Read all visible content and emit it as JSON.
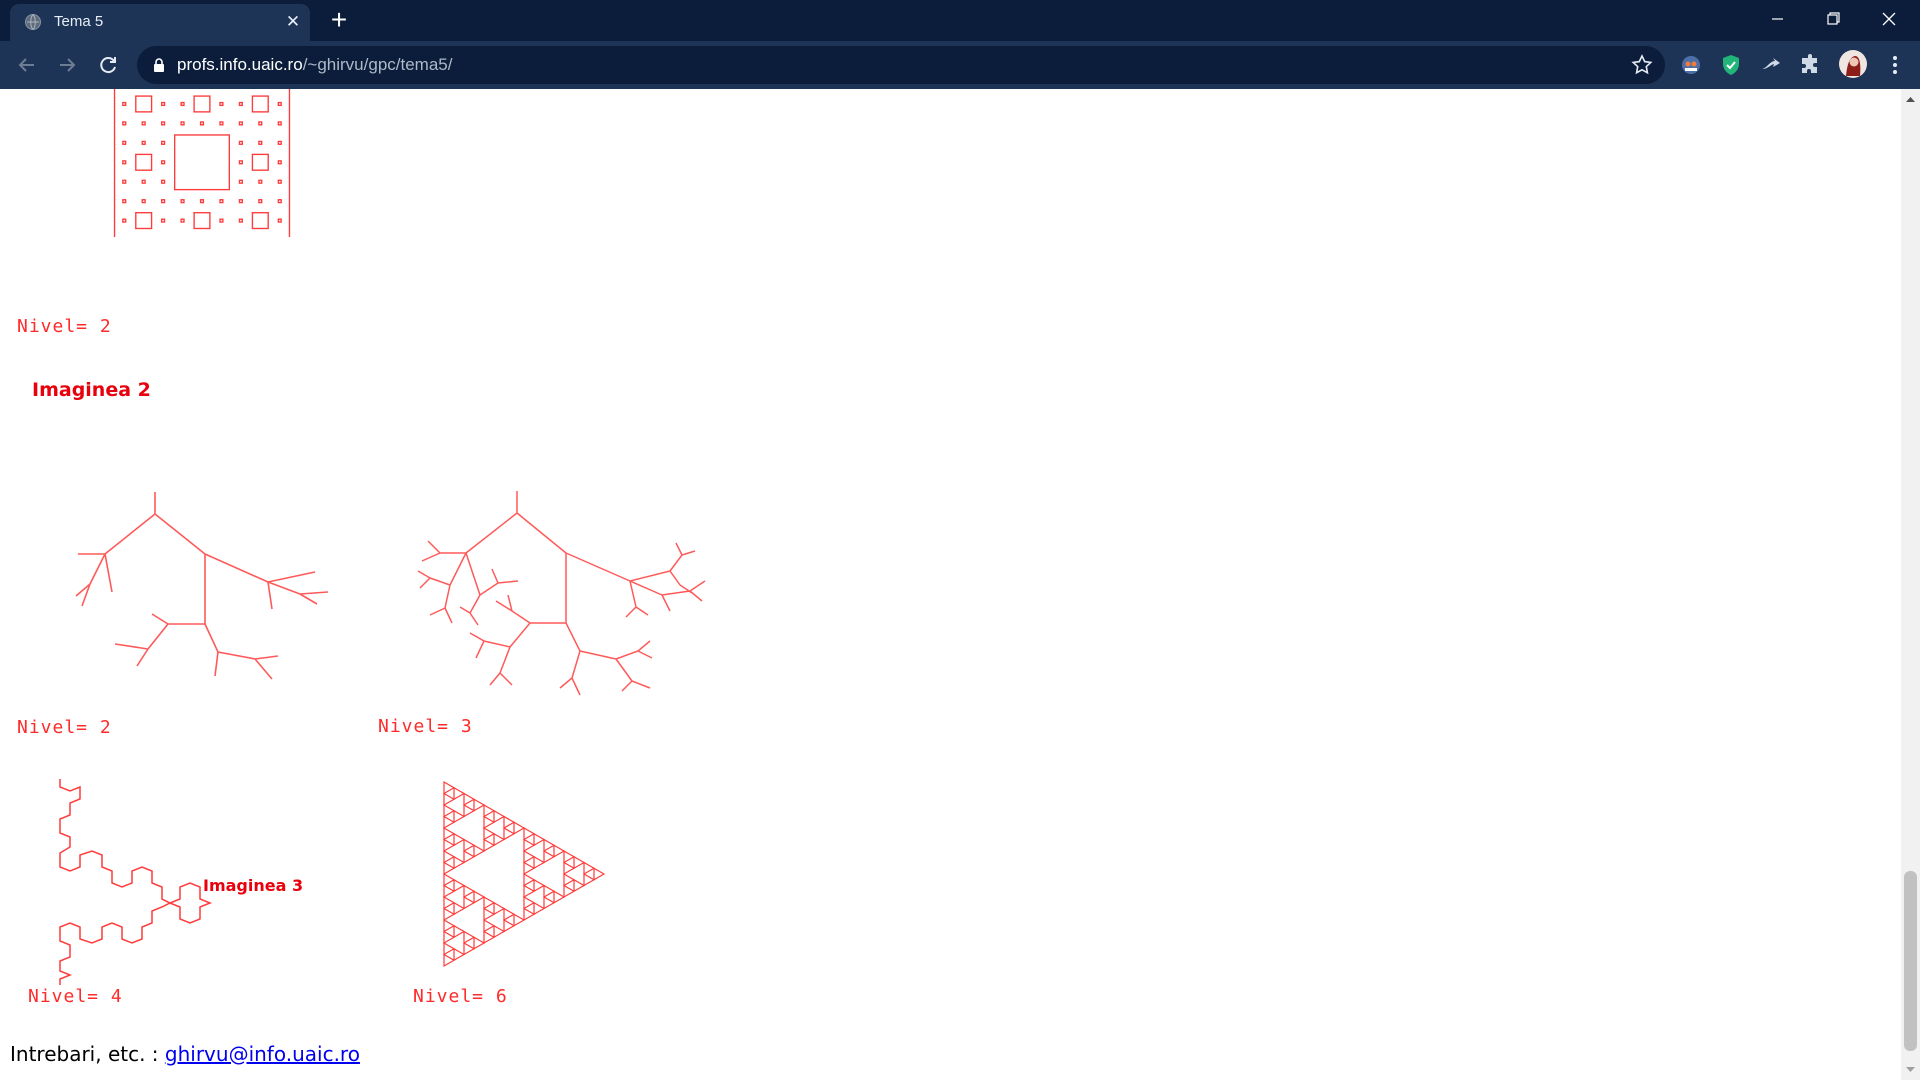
{
  "browser": {
    "tab_title": "Tema 5",
    "new_tab_label": "+",
    "close_tab_label": "✕",
    "url_host": "profs.info.uaic.ro",
    "url_path": "/~ghirvu/gpc/tema5/"
  },
  "page": {
    "sections": [
      {
        "nivel_label": "Nivel= 2"
      },
      {
        "heading": "Imaginea 2",
        "figures": [
          {
            "nivel_label": "Nivel= 2"
          },
          {
            "nivel_label": "Nivel= 3"
          }
        ]
      },
      {
        "heading": "Imaginea 3",
        "figures": [
          {
            "nivel_label": "Nivel= 4"
          },
          {
            "nivel_label": "Nivel= 6"
          }
        ]
      }
    ],
    "footer": {
      "prefix": "Intrebari, etc. : ",
      "email": "ghirvu@info.uaic.ro"
    }
  },
  "colors": {
    "fractal": "#ff3b3b",
    "heading": "#e8000c",
    "link": "#0000ee"
  },
  "icons": [
    "globe-icon",
    "close-icon",
    "plus-icon",
    "minimize-icon",
    "restore-icon",
    "window-close-icon",
    "back-arrow-icon",
    "forward-arrow-icon",
    "reload-icon",
    "lock-icon",
    "star-icon",
    "extension-icons",
    "profile-avatar",
    "more-icon"
  ]
}
